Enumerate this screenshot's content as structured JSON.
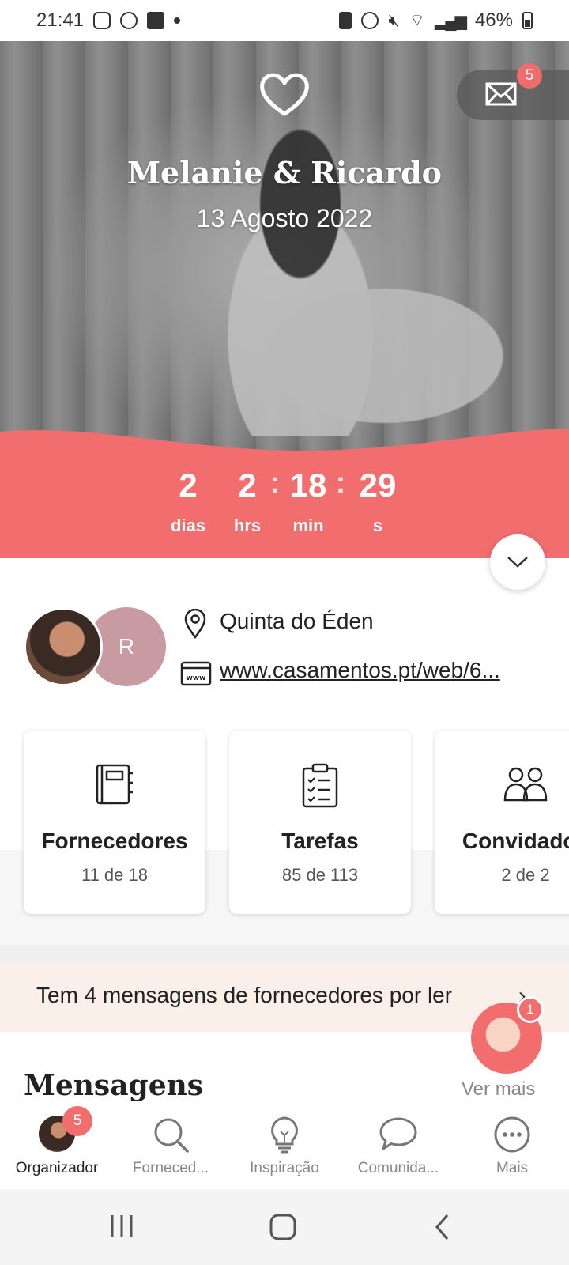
{
  "status_bar": {
    "time": "21:41",
    "battery": "46%"
  },
  "hero": {
    "couple_name": "Melanie & Ricardo",
    "date": "13 Agosto 2022",
    "mail_badge": "5"
  },
  "countdown": {
    "days": "2",
    "hours": "2",
    "minutes": "18",
    "seconds": "29",
    "separator": ":",
    "labels": {
      "days": "dias",
      "hours": "hrs",
      "minutes": "min",
      "seconds": "s"
    }
  },
  "profile": {
    "partner_initial": "R",
    "venue": "Quinta do Éden",
    "website": "www.casamentos.pt/web/6..."
  },
  "cards": [
    {
      "title": "Fornecedores",
      "subtitle": "11 de 18",
      "icon": "notebook-icon"
    },
    {
      "title": "Tarefas",
      "subtitle": "85 de 113",
      "icon": "checklist-icon"
    },
    {
      "title": "Convidados",
      "subtitle": "2 de 2",
      "icon": "guests-icon"
    }
  ],
  "notice": {
    "text": "Tem 4 mensagens de fornecedores por ler"
  },
  "assistant": {
    "badge": "1"
  },
  "messages_section": {
    "title": "Mensagens",
    "see_more": "Ver mais"
  },
  "bottom_nav": [
    {
      "label": "Organizador",
      "badge": "5"
    },
    {
      "label": "Forneced..."
    },
    {
      "label": "Inspiração"
    },
    {
      "label": "Comunida..."
    },
    {
      "label": "Mais"
    }
  ],
  "colors": {
    "accent": "#f26e6e",
    "notice_bg": "#fbefe9",
    "partner_avatar": "#c89aa2"
  }
}
